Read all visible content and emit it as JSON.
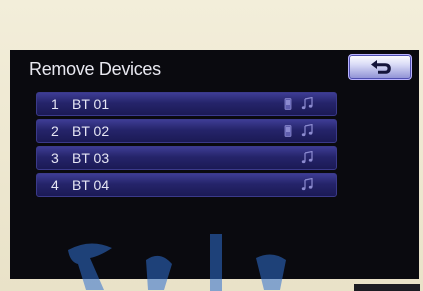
{
  "screen": {
    "title": "Remove Devices",
    "back_button": {
      "icon": "back-arrow-icon"
    }
  },
  "devices": [
    {
      "number": "1",
      "name": "BT 01",
      "icons": [
        "phone-icon",
        "music-icon"
      ]
    },
    {
      "number": "2",
      "name": "BT 02",
      "icons": [
        "phone-icon",
        "music-icon"
      ]
    },
    {
      "number": "3",
      "name": "BT 03",
      "icons": [
        "music-icon"
      ]
    },
    {
      "number": "4",
      "name": "BT 04",
      "icons": [
        "music-icon"
      ]
    }
  ],
  "colors": {
    "screen_background": "#0a0a0f",
    "row_background": "#25246a",
    "back_button_border": "#b9b3ff",
    "text": "#e8e8f0"
  }
}
